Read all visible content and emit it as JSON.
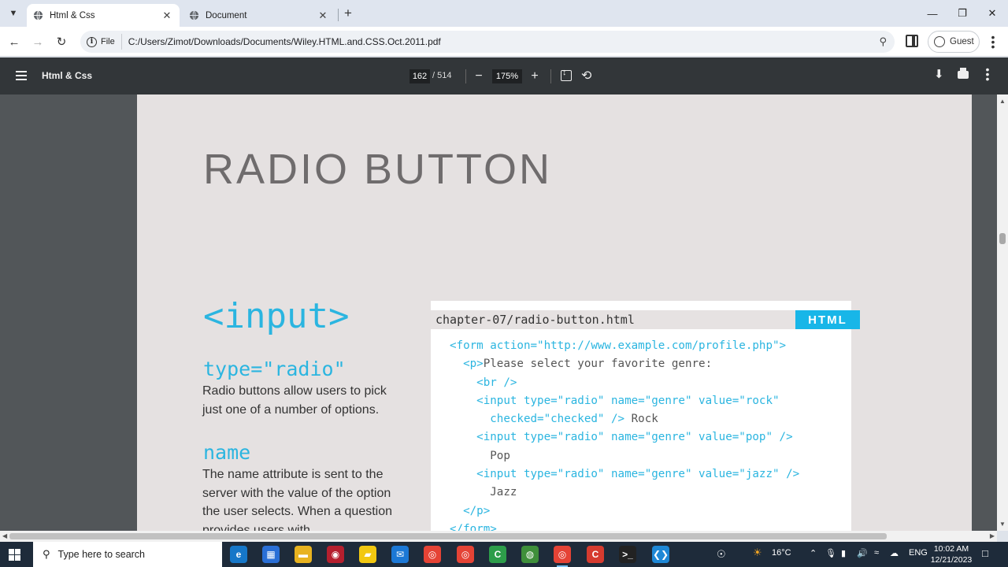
{
  "tabs": [
    {
      "title": "Html & Css",
      "active": true
    },
    {
      "title": "Document",
      "active": false
    }
  ],
  "address": {
    "scheme_chip": "File",
    "url": "C:/Users/Zimot/Downloads/Documents/Wiley.HTML.and.CSS.Oct.2011.pdf"
  },
  "profile": {
    "label": "Guest"
  },
  "pdf_toolbar": {
    "title": "Html & Css",
    "current_page": "162",
    "total_pages": "/ 514",
    "zoom": "175%"
  },
  "page": {
    "heading": "RADIO BUTTON",
    "tag_title": "<input>",
    "attributes": [
      {
        "name": "type=\"radio\"",
        "description": "Radio buttons allow users to pick just one of a number of options."
      },
      {
        "name": "name",
        "description": "The name attribute is sent to the server with the value of the option the user selects. When a question provides users with"
      }
    ],
    "code_example": {
      "filename": "chapter-07/radio-button.html",
      "badge": "HTML",
      "lines": [
        {
          "tag": "<form action=\"http://www.example.com/profile.php\">",
          "text": ""
        },
        {
          "tag": "  <p>",
          "text": "Please select your favorite genre:"
        },
        {
          "tag": "    <br />",
          "text": ""
        },
        {
          "tag": "    <input type=\"radio\" name=\"genre\" value=\"rock\"",
          "text": ""
        },
        {
          "tag": "      checked=\"checked\" />",
          "text": " Rock"
        },
        {
          "tag": "    <input type=\"radio\" name=\"genre\" value=\"pop\" />",
          "text": ""
        },
        {
          "tag": "",
          "text": "      Pop"
        },
        {
          "tag": "    <input type=\"radio\" name=\"genre\" value=\"jazz\" />",
          "text": ""
        },
        {
          "tag": "",
          "text": "      Jazz"
        },
        {
          "tag": "  </p>",
          "text": ""
        },
        {
          "tag": "</form>",
          "text": ""
        }
      ]
    }
  },
  "taskbar": {
    "search_placeholder": "Type here to search",
    "apps": [
      {
        "name": "edge",
        "color": "#1677c8",
        "glyph": "e"
      },
      {
        "name": "store",
        "color": "#2a6fd6",
        "glyph": "▦"
      },
      {
        "name": "file-explorer",
        "color": "#e8b320",
        "glyph": "▬"
      },
      {
        "name": "app-red",
        "color": "#b51f2e",
        "glyph": "◉"
      },
      {
        "name": "sticky-notes",
        "color": "#f2c811",
        "glyph": "▰"
      },
      {
        "name": "mail",
        "color": "#1b78d6",
        "glyph": "✉"
      },
      {
        "name": "chrome-1",
        "color": "#e54335",
        "glyph": "◎"
      },
      {
        "name": "chrome-2",
        "color": "#e54335",
        "glyph": "◎"
      },
      {
        "name": "camtasia-green",
        "color": "#2d9d4a",
        "glyph": "C"
      },
      {
        "name": "globe-app",
        "color": "#3f8f3a",
        "glyph": "◍"
      },
      {
        "name": "chrome-active",
        "color": "#e54335",
        "glyph": "◎"
      },
      {
        "name": "camtasia-red",
        "color": "#d63b2f",
        "glyph": "C"
      },
      {
        "name": "terminal",
        "color": "#222222",
        "glyph": ">_"
      },
      {
        "name": "vscode",
        "color": "#1e88d6",
        "glyph": "❮❯"
      }
    ],
    "weather": "16°C",
    "language": "ENG",
    "time": "10:02 AM",
    "date": "12/21/2023"
  },
  "colors": {
    "accent": "#2bb5e0",
    "html_badge": "#18b6e8",
    "pdf_toolbar": "#323639",
    "viewer_bg": "#525659"
  }
}
